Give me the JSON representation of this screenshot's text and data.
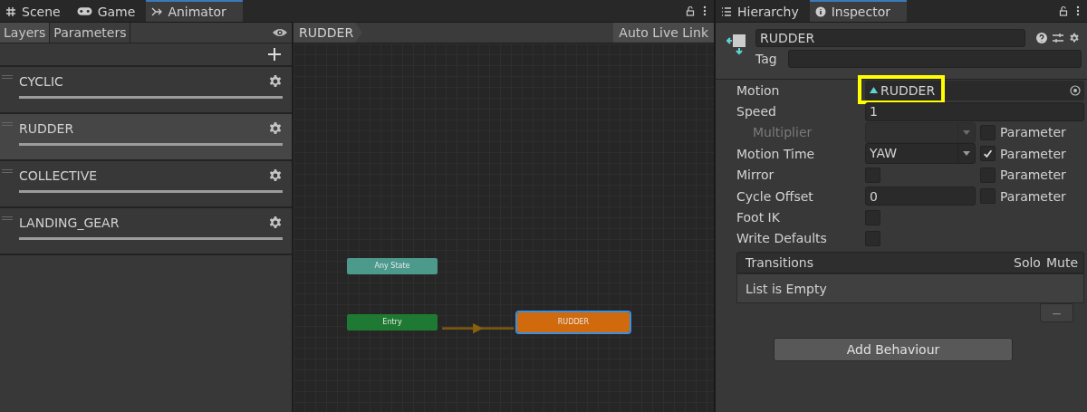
{
  "left_tabs": [
    {
      "label": "Scene",
      "selected": false
    },
    {
      "label": "Game",
      "selected": false
    },
    {
      "label": "Animator",
      "selected": true
    }
  ],
  "animator": {
    "subtabs": [
      {
        "label": "Layers",
        "selected": true
      },
      {
        "label": "Parameters",
        "selected": false
      }
    ],
    "breadcrumb": "RUDDER",
    "live_link": "Auto Live Link",
    "layers": [
      {
        "name": "CYCLIC",
        "selected": false,
        "level": 1
      },
      {
        "name": "RUDDER",
        "selected": true,
        "level": 1
      },
      {
        "name": "COLLECTIVE",
        "selected": false,
        "level": 1
      },
      {
        "name": "LANDING_GEAR",
        "selected": false,
        "level": 1
      }
    ],
    "nodes": [
      {
        "label": "Any State",
        "kind": "any",
        "selected": false
      },
      {
        "label": "Entry",
        "kind": "entry",
        "selected": false
      },
      {
        "label": "RUDDER",
        "kind": "default",
        "selected": true
      }
    ]
  },
  "right_tabs": [
    {
      "label": "Hierarchy",
      "selected": false
    },
    {
      "label": "Inspector",
      "selected": true
    }
  ],
  "inspector": {
    "name": "RUDDER",
    "tag_label": "Tag",
    "rows": [
      {
        "label": "Motion",
        "kind": "object",
        "value": "RUDDER",
        "highlighted": true
      },
      {
        "label": "Speed",
        "kind": "text",
        "value": "1"
      },
      {
        "label": "Multiplier",
        "kind": "dropdown",
        "disabled": true,
        "parameter": {
          "label": "Parameter",
          "checked": false
        }
      },
      {
        "label": "Motion Time",
        "kind": "dropdown",
        "value": "YAW",
        "parameter": {
          "label": "Parameter",
          "checked": true
        }
      },
      {
        "label": "Mirror",
        "kind": "checkbox",
        "checked": false,
        "parameter": {
          "label": "Parameter",
          "checked": false
        }
      },
      {
        "label": "Cycle Offset",
        "kind": "text",
        "value": "0",
        "parameter": {
          "label": "Parameter",
          "checked": false
        }
      },
      {
        "label": "Foot IK",
        "kind": "checkbox",
        "checked": false
      },
      {
        "label": "Write Defaults",
        "kind": "checkbox",
        "checked": false
      }
    ],
    "transitions": {
      "title": "Transitions",
      "columns": [
        "Solo",
        "Mute"
      ],
      "empty": "List is Empty",
      "remove": "−"
    },
    "add_button": "Add Behaviour"
  }
}
